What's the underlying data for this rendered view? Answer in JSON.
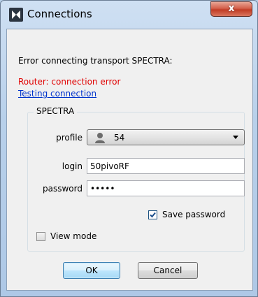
{
  "window": {
    "title": "Connections",
    "close_label": "x"
  },
  "dialog": {
    "message": "Error connecting transport SPECTRA:",
    "error_text": "Router: connection error",
    "link_text": "Testing connection"
  },
  "group": {
    "title": "SPECTRA",
    "profile_label": "profile",
    "profile_value": "54",
    "login_label": "login",
    "login_value": "50pivoRF",
    "password_label": "password",
    "password_value": "•••••",
    "save_password_label": "Save password",
    "save_password_checked": true
  },
  "view_mode": {
    "label": "View mode",
    "checked": false
  },
  "buttons": {
    "ok": "OK",
    "cancel": "Cancel"
  }
}
